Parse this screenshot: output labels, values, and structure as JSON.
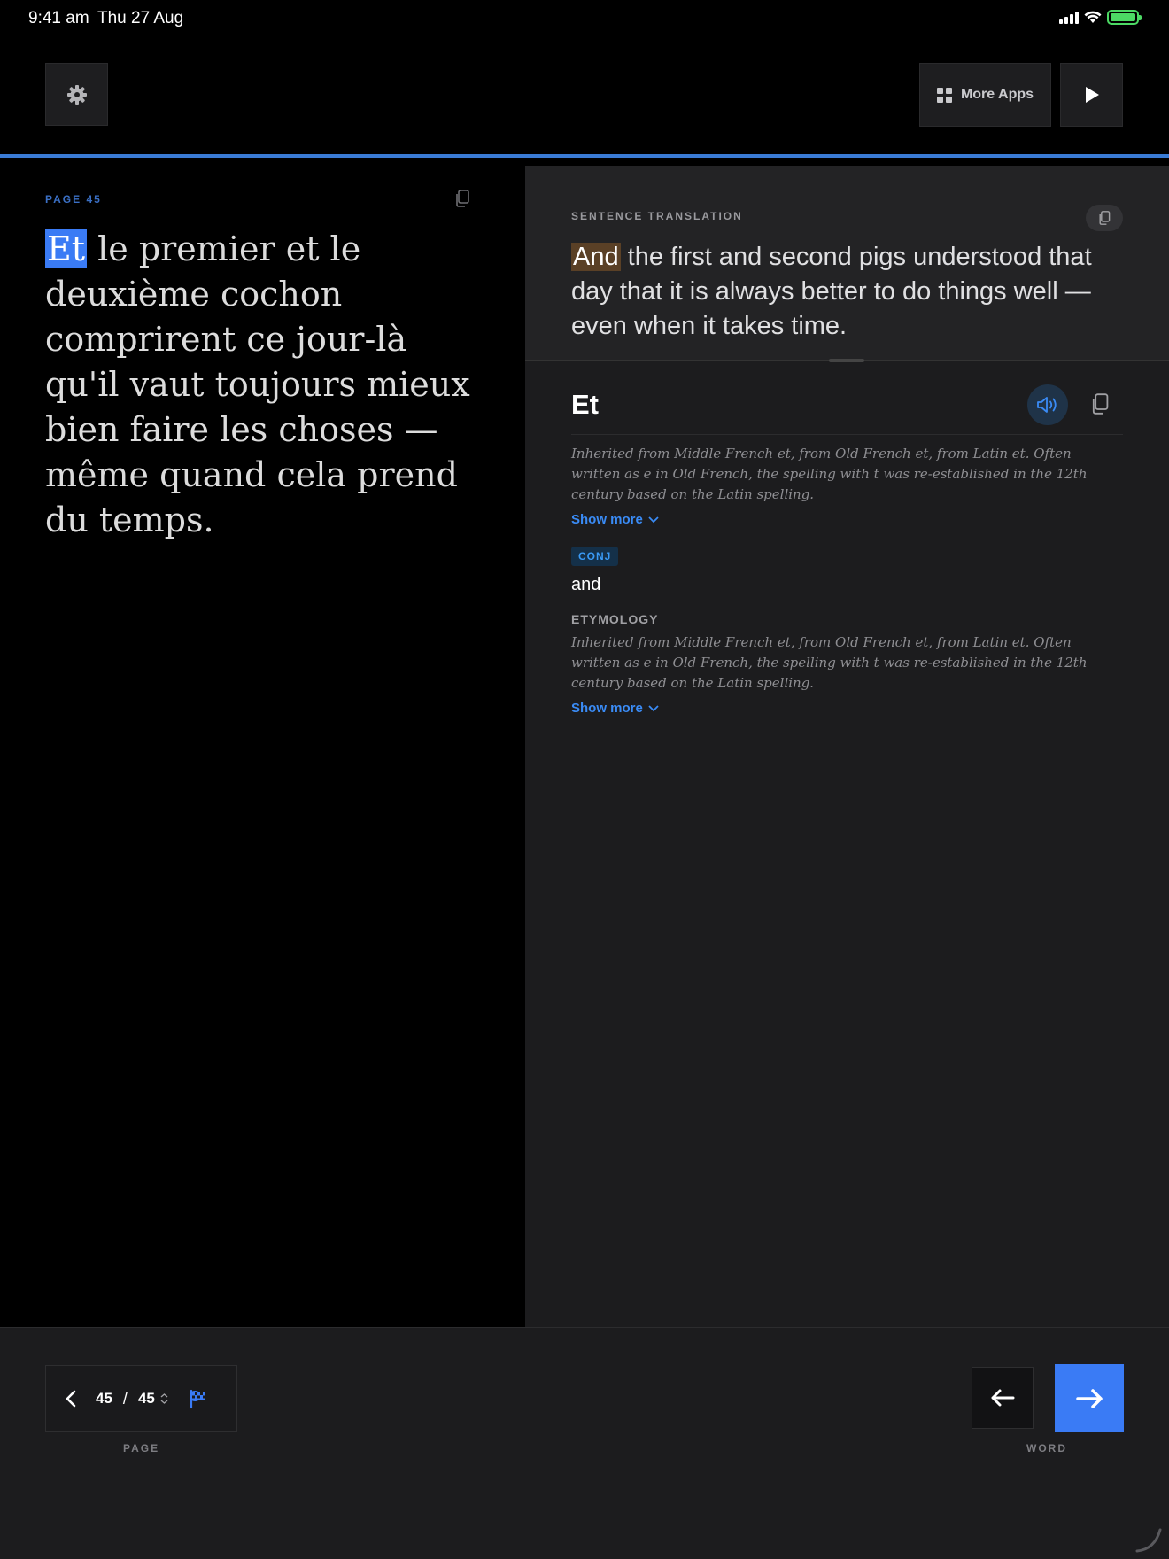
{
  "status_bar": {
    "time": "9:41 am",
    "date": "Thu 27 Aug"
  },
  "toolbar": {
    "settings_icon": "gear-icon",
    "more_apps_label": "More Apps",
    "play_icon": "play-icon"
  },
  "source": {
    "page_label": "PAGE  45",
    "highlighted_word": "Et",
    "rest_text": " le premier et le deuxième cochon comprirent ce jour-là qu'il  vaut toujours mieux bien faire les choses — même quand cela prend du temps."
  },
  "translation": {
    "label": "SENTENCE TRANSLATION",
    "highlighted_word": "And",
    "rest_text": " the first and second pigs understood that day that it is always better to do things well — even when it takes time."
  },
  "word": {
    "heading": "Et",
    "etymology_intro": "Inherited from Middle French et, from Old French et, from Latin et. Often written as e in Old French, the spelling with t was re-established in the 12th century based on the Latin spelling.",
    "show_more_1": "Show more",
    "pos": "CONJ",
    "definition": "and",
    "etymology_label": "ETYMOLOGY",
    "etymology_text": "Inherited from Middle French et, from Old French et, from Latin et. Often written as e in Old French, the spelling with t was re-established in the 12th century based on the Latin spelling.",
    "show_more_2": "Show more"
  },
  "bottom": {
    "current_page": "45",
    "separator": "/",
    "total_pages": "45",
    "page_label": "PAGE",
    "word_label": "WORD"
  },
  "colors": {
    "accent": "#3a7bf5",
    "source_highlight": "#3a7bf5",
    "translation_highlight": "#5a4026"
  }
}
